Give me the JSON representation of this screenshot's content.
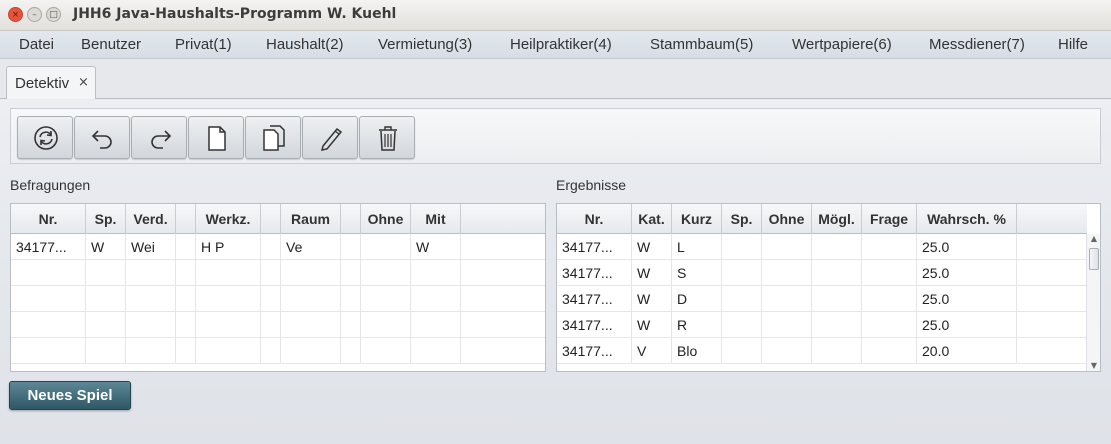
{
  "window": {
    "title": "JHH6 Java-Haushalts-Programm W. Kuehl",
    "close_glyph": "×",
    "min_glyph": "–",
    "max_glyph": "□"
  },
  "menu": [
    "Datei",
    "Benutzer",
    "Privat(1)",
    "Haushalt(2)",
    "Vermietung(3)",
    "Heilpraktiker(4)",
    "Stammbaum(5)",
    "Wertpapiere(6)",
    "Messdiener(7)",
    "Hilfe"
  ],
  "tab": {
    "label": "Detektiv",
    "close": "×"
  },
  "toolbar": {
    "buttons": [
      "refresh-icon",
      "undo-icon",
      "redo-icon",
      "new-document-icon",
      "copy-document-icon",
      "edit-pencil-icon",
      "delete-trash-icon"
    ]
  },
  "befragungen": {
    "label": "Befragungen",
    "columns": [
      "Nr.",
      "Sp.",
      "Verd.",
      "",
      "Werkz.",
      "",
      "Raum",
      "",
      "Ohne",
      "Mit"
    ],
    "rows": [
      [
        "34177...",
        "W",
        "Wei",
        "",
        "H P",
        "",
        "Ve",
        "",
        "",
        "W"
      ],
      [
        "",
        "",
        "",
        "",
        "",
        "",
        "",
        "",
        "",
        ""
      ],
      [
        "",
        "",
        "",
        "",
        "",
        "",
        "",
        "",
        "",
        ""
      ],
      [
        "",
        "",
        "",
        "",
        "",
        "",
        "",
        "",
        "",
        ""
      ],
      [
        "",
        "",
        "",
        "",
        "",
        "",
        "",
        "",
        "",
        ""
      ]
    ]
  },
  "ergebnisse": {
    "label": "Ergebnisse",
    "columns": [
      "Nr.",
      "Kat.",
      "Kurz",
      "Sp.",
      "Ohne",
      "Mögl.",
      "Frage",
      "Wahrsch. %"
    ],
    "rows": [
      [
        "34177...",
        "W",
        "L",
        "",
        "",
        "",
        "",
        "25.0"
      ],
      [
        "34177...",
        "W",
        "S",
        "",
        "",
        "",
        "",
        "25.0"
      ],
      [
        "34177...",
        "W",
        "D",
        "",
        "",
        "",
        "",
        "25.0"
      ],
      [
        "34177...",
        "W",
        "R",
        "",
        "",
        "",
        "",
        "25.0"
      ],
      [
        "34177...",
        "V",
        "Blo",
        "",
        "",
        "",
        "",
        "20.0"
      ]
    ]
  },
  "new_game_button": "Neues Spiel"
}
